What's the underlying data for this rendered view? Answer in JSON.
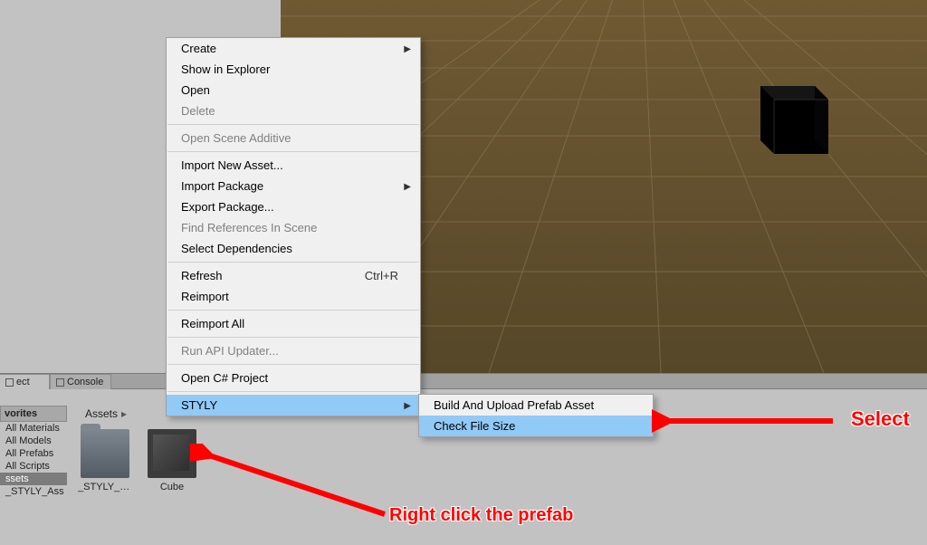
{
  "tabs": {
    "project": "ect",
    "console": "Console"
  },
  "breadcrumb": {
    "root": "Assets"
  },
  "sidebar": {
    "favorites_head": "vorites",
    "favorites": [
      "All Materials",
      "All Models",
      "All Prefabs",
      "All Scripts"
    ],
    "assets_head": "ssets",
    "asset_children": [
      "_STYLY_Ass"
    ]
  },
  "thumbs": [
    {
      "label": "_STYLY_A...",
      "kind": "folder"
    },
    {
      "label": "Cube",
      "kind": "cube"
    }
  ],
  "menu": {
    "create": "Create",
    "show_explorer": "Show in Explorer",
    "open": "Open",
    "delete": "Delete",
    "open_additive": "Open Scene Additive",
    "import_asset": "Import New Asset...",
    "import_package": "Import Package",
    "export_package": "Export Package...",
    "find_refs": "Find References In Scene",
    "select_deps": "Select Dependencies",
    "refresh": "Refresh",
    "refresh_sc": "Ctrl+R",
    "reimport": "Reimport",
    "reimport_all": "Reimport All",
    "api_updater": "Run API Updater...",
    "open_cs": "Open C# Project",
    "styly": "STYLY"
  },
  "submenu": {
    "build_upload": "Build And Upload Prefab Asset",
    "check_size": "Check File Size"
  },
  "annotations": {
    "select": "Select",
    "right_click": "Right click the prefab"
  }
}
